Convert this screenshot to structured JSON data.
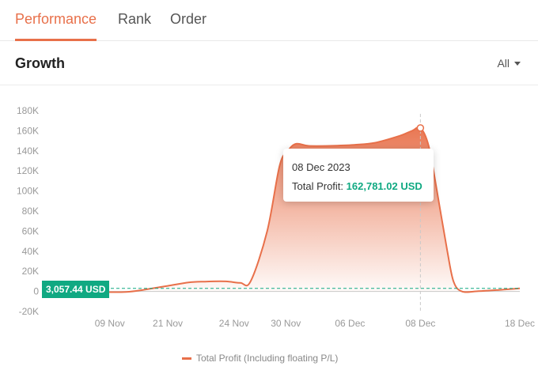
{
  "tabs": [
    {
      "label": "Performance",
      "active": true
    },
    {
      "label": "Rank",
      "active": false
    },
    {
      "label": "Order",
      "active": false
    }
  ],
  "section": {
    "title": "Growth",
    "range_label": "All"
  },
  "current_value_label": "3,057.44 USD",
  "tooltip": {
    "date": "08 Dec 2023",
    "label": "Total Profit:",
    "value": "162,781.02 USD"
  },
  "legend": {
    "label": "Total Profit (Including floating P/L)",
    "icon": "line-swatch-icon"
  },
  "colors": {
    "accent": "#e8704a",
    "positive": "#10a982"
  },
  "chart_data": {
    "type": "area",
    "y_ticks": [
      "180K",
      "160K",
      "140K",
      "120K",
      "100K",
      "80K",
      "60K",
      "40K",
      "20K",
      "0",
      "-20K"
    ],
    "x_ticks": [
      "09 Nov",
      "21 Nov",
      "24 Nov",
      "30 Nov",
      "06 Dec",
      "08 Dec",
      "18 Dec"
    ],
    "ylim": [
      -20000,
      180000
    ],
    "grid": false,
    "legend_placement": "bottom",
    "series": [
      {
        "name": "Total Profit (Including floating P/L)",
        "points": [
          [
            0,
            0
          ],
          [
            10,
            -300
          ],
          [
            20,
            -500
          ],
          [
            30,
            -700
          ],
          [
            40,
            -500
          ],
          [
            48,
            1500
          ],
          [
            60,
            5500
          ],
          [
            70,
            9000
          ],
          [
            78,
            9800
          ],
          [
            88,
            10000
          ],
          [
            95,
            8500
          ],
          [
            100,
            10000
          ],
          [
            108,
            60000
          ],
          [
            114,
            125000
          ],
          [
            118,
            140000
          ],
          [
            122,
            147000
          ],
          [
            128,
            145000
          ],
          [
            138,
            145000
          ],
          [
            150,
            146000
          ],
          [
            160,
            148000
          ],
          [
            172,
            155000
          ],
          [
            178,
            160000
          ],
          [
            182,
            162781
          ],
          [
            186,
            145000
          ],
          [
            190,
            100000
          ],
          [
            195,
            40000
          ],
          [
            198,
            10000
          ],
          [
            202,
            0
          ],
          [
            210,
            200
          ],
          [
            220,
            1500
          ],
          [
            230,
            3057
          ]
        ]
      }
    ],
    "x_tick_positions": [
      32,
      60,
      92,
      117,
      148,
      182,
      230
    ],
    "xlim": [
      0,
      230
    ],
    "current_value": 3057.44,
    "highlight": {
      "x": 182,
      "y": 162781.02
    }
  }
}
